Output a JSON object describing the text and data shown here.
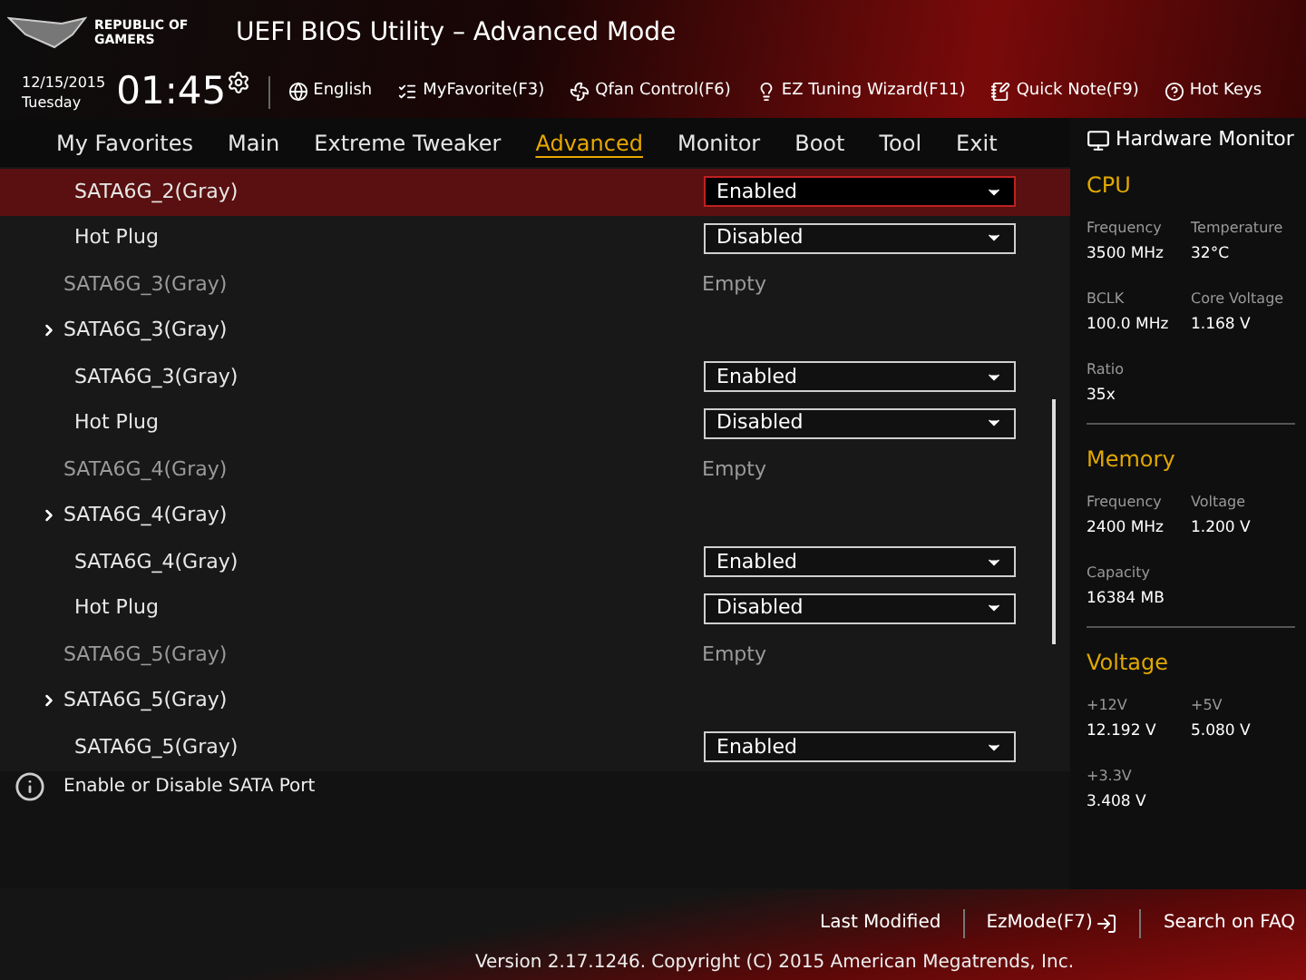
{
  "header": {
    "brand": "REPUBLIC OF GAMERS",
    "title": "UEFI BIOS Utility – Advanced Mode"
  },
  "toolbar": {
    "date": "12/15/2015",
    "day": "Tuesday",
    "time": "01:45",
    "items": [
      {
        "kind": "globe",
        "label": "English"
      },
      {
        "kind": "favorite",
        "label": "MyFavorite(F3)"
      },
      {
        "kind": "fan",
        "label": "Qfan Control(F6)"
      },
      {
        "kind": "bulb",
        "label": "EZ Tuning Wizard(F11)"
      },
      {
        "kind": "note",
        "label": "Quick Note(F9)"
      },
      {
        "kind": "help",
        "label": "Hot Keys"
      }
    ]
  },
  "tabs": [
    {
      "label": "My Favorites",
      "selected": false
    },
    {
      "label": "Main",
      "selected": false
    },
    {
      "label": "Extreme Tweaker",
      "selected": false
    },
    {
      "label": "Advanced",
      "selected": true
    },
    {
      "label": "Monitor",
      "selected": false
    },
    {
      "label": "Boot",
      "selected": false
    },
    {
      "label": "Tool",
      "selected": false
    },
    {
      "label": "Exit",
      "selected": false
    }
  ],
  "settings": [
    {
      "kind": "select",
      "label": "SATA6G_2(Gray)",
      "value": "Enabled",
      "selected": true
    },
    {
      "kind": "select",
      "label": "Hot Plug",
      "value": "Disabled",
      "selected": false
    },
    {
      "kind": "info",
      "label": "SATA6G_3(Gray)",
      "value": "Empty",
      "selected": false
    },
    {
      "kind": "submenu",
      "label": "SATA6G_3(Gray)",
      "selected": false
    },
    {
      "kind": "select",
      "label": "SATA6G_3(Gray)",
      "value": "Enabled",
      "selected": false
    },
    {
      "kind": "select",
      "label": "Hot Plug",
      "value": "Disabled",
      "selected": false
    },
    {
      "kind": "info",
      "label": "SATA6G_4(Gray)",
      "value": "Empty",
      "selected": false
    },
    {
      "kind": "submenu",
      "label": "SATA6G_4(Gray)",
      "selected": false
    },
    {
      "kind": "select",
      "label": "SATA6G_4(Gray)",
      "value": "Enabled",
      "selected": false
    },
    {
      "kind": "select",
      "label": "Hot Plug",
      "value": "Disabled",
      "selected": false
    },
    {
      "kind": "info",
      "label": "SATA6G_5(Gray)",
      "value": "Empty",
      "selected": false
    },
    {
      "kind": "submenu",
      "label": "SATA6G_5(Gray)",
      "selected": false
    },
    {
      "kind": "select",
      "label": "SATA6G_5(Gray)",
      "value": "Enabled",
      "selected": false
    }
  ],
  "help": "Enable or Disable SATA Port",
  "hardware_monitor": {
    "title": "Hardware Monitor",
    "sections": [
      {
        "title": "CPU",
        "stats": [
          {
            "label": "Frequency",
            "value": "3500 MHz"
          },
          {
            "label": "Temperature",
            "value": "32°C"
          },
          {
            "label": "BCLK",
            "value": "100.0 MHz"
          },
          {
            "label": "Core Voltage",
            "value": "1.168 V"
          },
          {
            "label": "Ratio",
            "value": "35x"
          }
        ]
      },
      {
        "title": "Memory",
        "stats": [
          {
            "label": "Frequency",
            "value": "2400 MHz"
          },
          {
            "label": "Voltage",
            "value": "1.200 V"
          },
          {
            "label": "Capacity",
            "value": "16384 MB"
          }
        ]
      },
      {
        "title": "Voltage",
        "stats": [
          {
            "label": "+12V",
            "value": "12.192 V"
          },
          {
            "label": "+5V",
            "value": "5.080 V"
          },
          {
            "label": "+3.3V",
            "value": "3.408 V"
          }
        ]
      }
    ]
  },
  "footer": {
    "links": [
      {
        "kind": "text",
        "label": "Last Modified"
      },
      {
        "kind": "exit",
        "label": "EzMode(F7)"
      },
      {
        "kind": "text",
        "label": "Search on FAQ"
      }
    ],
    "version": "Version 2.17.1246. Copyright (C) 2015 American Megatrends, Inc."
  }
}
